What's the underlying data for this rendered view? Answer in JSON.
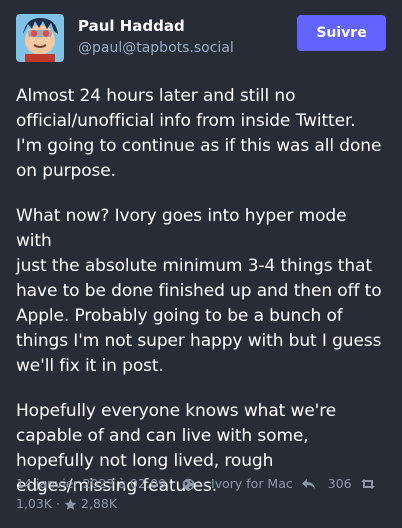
{
  "author": {
    "display_name": "Paul Haddad",
    "handle": "@paul@tapbots.social"
  },
  "follow_button": {
    "label": "Suivre"
  },
  "post": {
    "paragraphs": [
      "Almost 24 hours later and still no\nofficial/unofficial info from inside Twitter.\nI'm going to continue as if this was all done\non purpose.",
      "What now? Ivory goes into hyper mode with\njust the absolute minimum 3-4 things that\nhave to be done finished up and then off to\nApple. Probably going to be a bunch of\nthings I'm not super happy with but I guess\nwe'll fix it in post.",
      "Hopefully everyone knows what we're\ncapable of and can live with some,\nhopefully not long lived, rough\nedges/missing features."
    ]
  },
  "meta": {
    "timestamp": "14 janvier 2023 à 02:09",
    "separator": "·",
    "visibility_icon": "globe-icon",
    "application": "Ivory for Mac",
    "replies_icon": "reply-icon",
    "replies": "306",
    "boosts_icon": "boost-icon",
    "boosts": "1,03K",
    "favourites_icon": "star-icon",
    "favourites": "2,88K"
  },
  "colors": {
    "background": "#282c37",
    "accent": "#6364ff",
    "text": "#ffffff",
    "secondary_text": "#9baec8",
    "meta_text": "#8d96a8"
  }
}
